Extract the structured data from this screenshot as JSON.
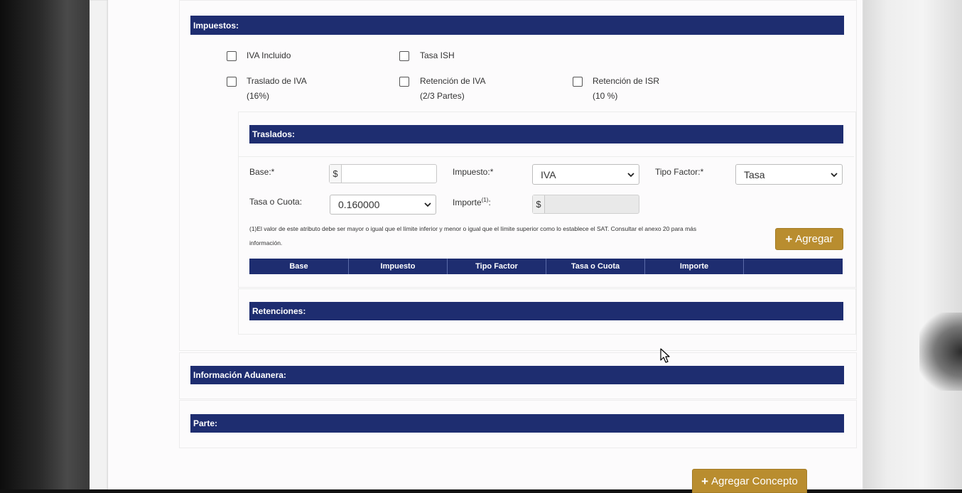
{
  "impuestos": {
    "header": "Impuestos:",
    "checkboxes": [
      {
        "label": "IVA Incluido",
        "sub": "",
        "checked": false
      },
      {
        "label": "Tasa ISH",
        "sub": "",
        "checked": false
      },
      {
        "label": "Traslado de IVA",
        "sub": "(16%)",
        "checked": false
      },
      {
        "label": "Retención de IVA",
        "sub": "(2/3 Partes)",
        "checked": false
      },
      {
        "label": "Retención de ISR",
        "sub": "(10 %)",
        "checked": false
      }
    ]
  },
  "traslados": {
    "header": "Traslados:",
    "base_label": "Base:*",
    "base_addon": "$",
    "base_value": "",
    "impuesto_label": "Impuesto:*",
    "impuesto_value": "IVA",
    "tipo_factor_label": "Tipo Factor:*",
    "tipo_factor_value": "Tasa",
    "tasa_label": "Tasa o Cuota:",
    "tasa_value": "0.160000",
    "importe_label": "Importe",
    "importe_sup": "(1)",
    "importe_colon": ":",
    "importe_addon": "$",
    "importe_value": "",
    "note_line1": "(1)El valor de este atributo debe ser mayor o igual que el límite inferior y menor o igual que el límite superior como lo establece el SAT. Consultar el anexo 20 para más",
    "note_line2": "información.",
    "add_button": "Agregar",
    "table_headers": [
      "Base",
      "Impuesto",
      "Tipo Factor",
      "Tasa o Cuota",
      "Importe",
      ""
    ]
  },
  "retenciones": {
    "header": "Retenciones:"
  },
  "aduanera": {
    "header": "Información Aduanera:"
  },
  "parte": {
    "header": "Parte:"
  },
  "agregar_concepto": "Agregar Concepto",
  "colors": {
    "header_bar": "#1e2d70",
    "button_gold": "#b98d2f"
  },
  "icons": {
    "plus": "plus-icon",
    "chevron": "chevron-down-icon",
    "checkbox": "checkbox-unchecked-icon",
    "cursor": "mouse-pointer-icon"
  }
}
